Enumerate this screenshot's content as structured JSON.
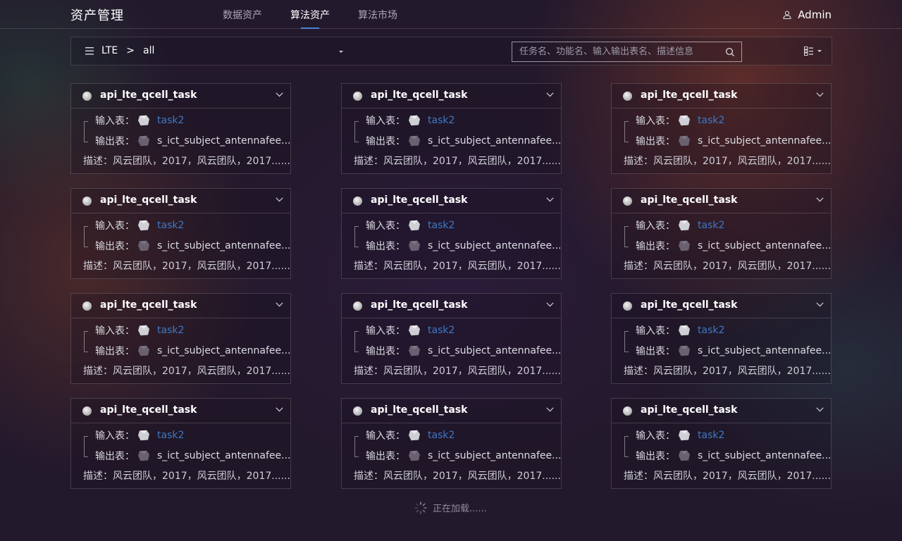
{
  "header": {
    "title": "资产管理",
    "nav": [
      {
        "label": "数据资产",
        "active": false
      },
      {
        "label": "算法资产",
        "active": true
      },
      {
        "label": "算法市场",
        "active": false
      }
    ],
    "user": {
      "name": "Admin",
      "icon": "user-icon"
    }
  },
  "filter": {
    "menu_icon": "menu-icon",
    "breadcrumb": {
      "root": "LTE",
      "separator": ">",
      "current": "all"
    },
    "search_placeholder": "任务名、功能名、输入输出表名、描述信息",
    "search_value": "",
    "view_icon": "grid-view-icon"
  },
  "cards": [
    {
      "title": "api_lte_qcell_task",
      "input_label": "输入表：",
      "input_value": "task2",
      "output_label": "输出表：",
      "output_value": "s_ict_subject_antennafee...",
      "description": "描述：风云团队，2017，风云团队，2017......"
    },
    {
      "title": "api_lte_qcell_task",
      "input_label": "输入表：",
      "input_value": "task2",
      "output_label": "输出表：",
      "output_value": "s_ict_subject_antennafee...",
      "description": "描述：风云团队，2017，风云团队，2017......"
    },
    {
      "title": "api_lte_qcell_task",
      "input_label": "输入表：",
      "input_value": "task2",
      "output_label": "输出表：",
      "output_value": "s_ict_subject_antennafee...",
      "description": "描述：风云团队，2017，风云团队，2017......"
    },
    {
      "title": "api_lte_qcell_task",
      "input_label": "输入表：",
      "input_value": "task2",
      "output_label": "输出表：",
      "output_value": "s_ict_subject_antennafee...",
      "description": "描述：风云团队，2017，风云团队，2017......"
    },
    {
      "title": "api_lte_qcell_task",
      "input_label": "输入表：",
      "input_value": "task2",
      "output_label": "输出表：",
      "output_value": "s_ict_subject_antennafee...",
      "description": "描述：风云团队，2017，风云团队，2017......"
    },
    {
      "title": "api_lte_qcell_task",
      "input_label": "输入表：",
      "input_value": "task2",
      "output_label": "输出表：",
      "output_value": "s_ict_subject_antennafee...",
      "description": "描述：风云团队，2017，风云团队，2017......"
    },
    {
      "title": "api_lte_qcell_task",
      "input_label": "输入表：",
      "input_value": "task2",
      "output_label": "输出表：",
      "output_value": "s_ict_subject_antennafee...",
      "description": "描述：风云团队，2017，风云团队，2017......"
    },
    {
      "title": "api_lte_qcell_task",
      "input_label": "输入表：",
      "input_value": "task2",
      "output_label": "输出表：",
      "output_value": "s_ict_subject_antennafee...",
      "description": "描述：风云团队，2017，风云团队，2017......"
    },
    {
      "title": "api_lte_qcell_task",
      "input_label": "输入表：",
      "input_value": "task2",
      "output_label": "输出表：",
      "output_value": "s_ict_subject_antennafee...",
      "description": "描述：风云团队，2017，风云团队，2017......"
    },
    {
      "title": "api_lte_qcell_task",
      "input_label": "输入表：",
      "input_value": "task2",
      "output_label": "输出表：",
      "output_value": "s_ict_subject_antennafee...",
      "description": "描述：风云团队，2017，风云团队，2017......"
    },
    {
      "title": "api_lte_qcell_task",
      "input_label": "输入表：",
      "input_value": "task2",
      "output_label": "输出表：",
      "output_value": "s_ict_subject_antennafee...",
      "description": "描述：风云团队，2017，风云团队，2017......"
    },
    {
      "title": "api_lte_qcell_task",
      "input_label": "输入表：",
      "input_value": "task2",
      "output_label": "输出表：",
      "output_value": "s_ict_subject_antennafee...",
      "description": "描述：风云团队，2017，风云团队，2017......"
    }
  ],
  "loading": {
    "text": "正在加载......",
    "icon": "spinner-icon"
  },
  "colors": {
    "accent": "#4a7fd0",
    "link": "#3f78c3",
    "background": "#23192c"
  }
}
